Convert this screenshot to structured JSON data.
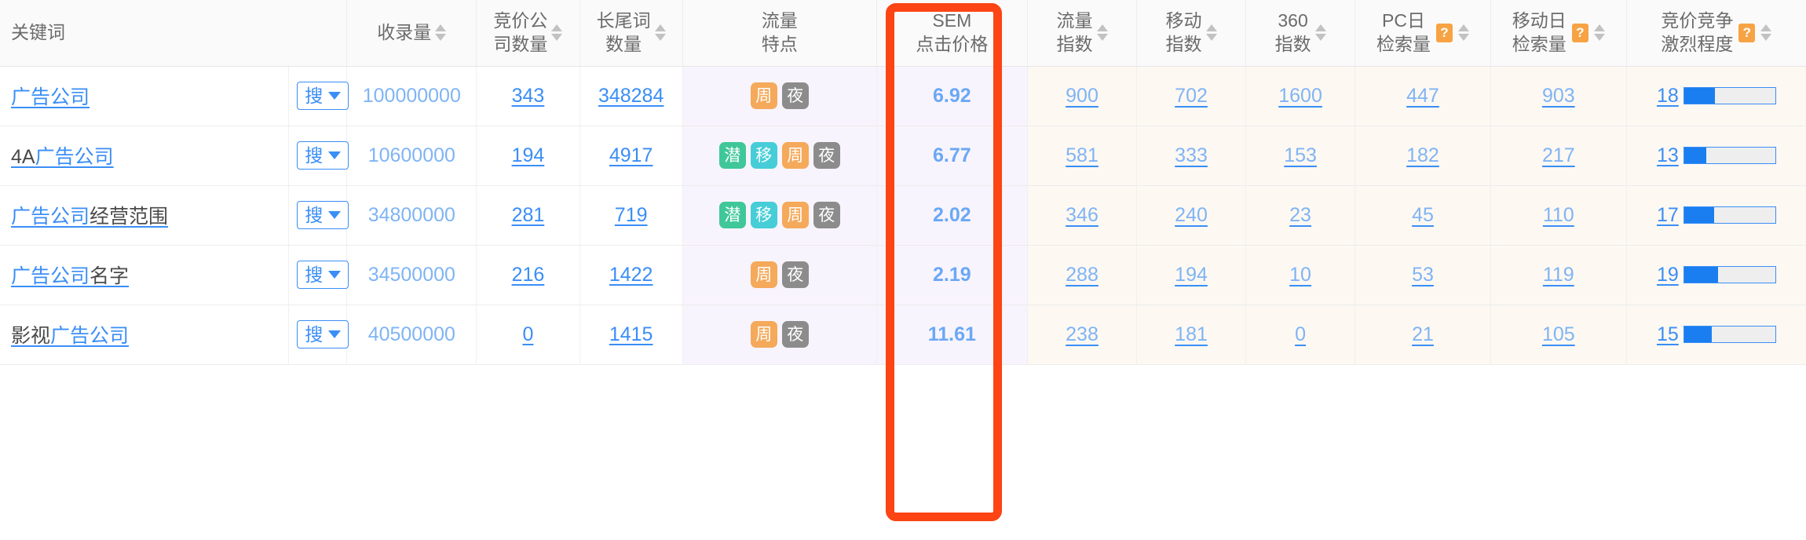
{
  "table": {
    "columns": [
      {
        "id": "keyword",
        "label_lines": [
          "关键词"
        ],
        "sortable": false,
        "help": false
      },
      {
        "id": "index_count",
        "label_lines": [
          "收录量"
        ],
        "sortable": true,
        "help": false
      },
      {
        "id": "bid_companies",
        "label_lines": [
          "竞价公",
          "司数量"
        ],
        "sortable": true,
        "help": false
      },
      {
        "id": "longtail_count",
        "label_lines": [
          "长尾词",
          "数量"
        ],
        "sortable": true,
        "help": false
      },
      {
        "id": "traffic_traits",
        "label_lines": [
          "流量",
          "特点"
        ],
        "sortable": false,
        "help": false
      },
      {
        "id": "sem_cpc",
        "label_lines": [
          "SEM",
          "点击价格"
        ],
        "sortable": false,
        "help": false
      },
      {
        "id": "traffic_index",
        "label_lines": [
          "流量",
          "指数"
        ],
        "sortable": true,
        "help": false
      },
      {
        "id": "mobile_index",
        "label_lines": [
          "移动",
          "指数"
        ],
        "sortable": true,
        "help": false
      },
      {
        "id": "index_360",
        "label_lines": [
          "360",
          "指数"
        ],
        "sortable": true,
        "help": false
      },
      {
        "id": "pc_daily",
        "label_lines": [
          "PC日",
          "检索量"
        ],
        "sortable": true,
        "help": true
      },
      {
        "id": "mobile_daily",
        "label_lines": [
          "移动日",
          "检索量"
        ],
        "sortable": true,
        "help": true
      },
      {
        "id": "competition",
        "label_lines": [
          "竞价竞争",
          "激烈程度"
        ],
        "sortable": true,
        "help": true
      }
    ],
    "search_button_label": "搜",
    "help_glyph": "?",
    "rows": [
      {
        "keyword_parts": [
          {
            "t": "广告公司",
            "hl": true
          }
        ],
        "index_count": "100000000",
        "bid_companies": "343",
        "longtail_count": "348284",
        "tags": [
          {
            "t": "周",
            "c": "orange"
          },
          {
            "t": "夜",
            "c": "gray"
          }
        ],
        "sem_cpc": "6.92",
        "traffic_index": "900",
        "mobile_index": "702",
        "index_360": "1600",
        "pc_daily": "447",
        "mobile_daily": "903",
        "competition_value": "18",
        "competition_percent": 34
      },
      {
        "keyword_parts": [
          {
            "t": "4A",
            "hl": false
          },
          {
            "t": "广告公司",
            "hl": true
          }
        ],
        "index_count": "10600000",
        "bid_companies": "194",
        "longtail_count": "4917",
        "tags": [
          {
            "t": "潜",
            "c": "green"
          },
          {
            "t": "移",
            "c": "cyan"
          },
          {
            "t": "周",
            "c": "orange"
          },
          {
            "t": "夜",
            "c": "gray"
          }
        ],
        "sem_cpc": "6.77",
        "traffic_index": "581",
        "mobile_index": "333",
        "index_360": "153",
        "pc_daily": "182",
        "mobile_daily": "217",
        "competition_value": "13",
        "competition_percent": 24
      },
      {
        "keyword_parts": [
          {
            "t": "广告公司",
            "hl": true
          },
          {
            "t": "经营范围",
            "hl": false
          }
        ],
        "index_count": "34800000",
        "bid_companies": "281",
        "longtail_count": "719",
        "tags": [
          {
            "t": "潜",
            "c": "green"
          },
          {
            "t": "移",
            "c": "cyan"
          },
          {
            "t": "周",
            "c": "orange"
          },
          {
            "t": "夜",
            "c": "gray"
          }
        ],
        "sem_cpc": "2.02",
        "traffic_index": "346",
        "mobile_index": "240",
        "index_360": "23",
        "pc_daily": "45",
        "mobile_daily": "110",
        "competition_value": "17",
        "competition_percent": 33
      },
      {
        "keyword_parts": [
          {
            "t": "广告公司",
            "hl": true
          },
          {
            "t": "名字",
            "hl": false
          }
        ],
        "index_count": "34500000",
        "bid_companies": "216",
        "longtail_count": "1422",
        "tags": [
          {
            "t": "周",
            "c": "orange"
          },
          {
            "t": "夜",
            "c": "gray"
          }
        ],
        "sem_cpc": "2.19",
        "traffic_index": "288",
        "mobile_index": "194",
        "index_360": "10",
        "pc_daily": "53",
        "mobile_daily": "119",
        "competition_value": "19",
        "competition_percent": 37
      },
      {
        "keyword_parts": [
          {
            "t": "影视",
            "hl": false
          },
          {
            "t": "广告公司",
            "hl": true
          }
        ],
        "index_count": "40500000",
        "bid_companies": "0",
        "longtail_count": "1415",
        "tags": [
          {
            "t": "周",
            "c": "orange"
          },
          {
            "t": "夜",
            "c": "gray"
          }
        ],
        "sem_cpc": "11.61",
        "traffic_index": "238",
        "mobile_index": "181",
        "index_360": "0",
        "pc_daily": "21",
        "mobile_daily": "105",
        "competition_value": "15",
        "competition_percent": 30
      }
    ]
  },
  "highlight": {
    "target_column": "sem_cpc",
    "color": "#fc4414"
  }
}
